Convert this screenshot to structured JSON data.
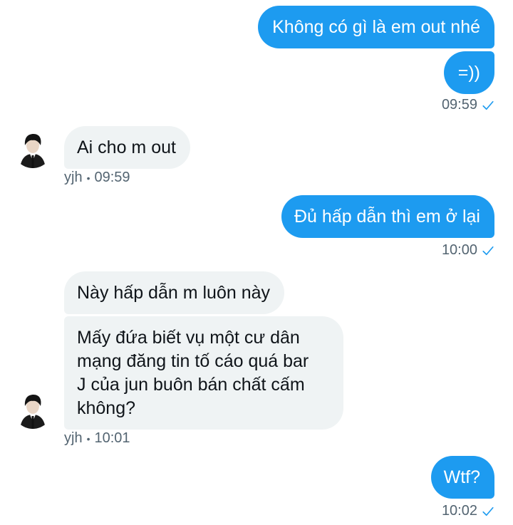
{
  "messages": {
    "m1": "Không có gì là em out nhé",
    "m2": "=))",
    "m2_time": "09:59",
    "m3": "Ai cho m out",
    "m3_sender": "yjh",
    "m3_time": "09:59",
    "m4": "Đủ hấp dẫn thì em ở lại",
    "m4_time": "10:00",
    "m5": "Này hấp dẫn m luôn này",
    "m6_line1": "Mấy đứa biết vụ một cư dân",
    "m6_line2": "mạng đăng tin tố cáo quá bar",
    "m6_line3": "J của jun buôn bán chất cấm",
    "m6_line4": "không?",
    "m6_sender": "yjh",
    "m6_time": "10:01",
    "m7": "Wtf?",
    "m7_time": "10:02"
  },
  "separator": "•",
  "colors": {
    "outgoing_bubble": "#1d9bf0",
    "incoming_bubble": "#eff3f4",
    "meta_text": "#536471",
    "check": "#1d9bf0"
  },
  "icons": {
    "read_receipt": "check-icon",
    "avatar": "user-avatar"
  }
}
